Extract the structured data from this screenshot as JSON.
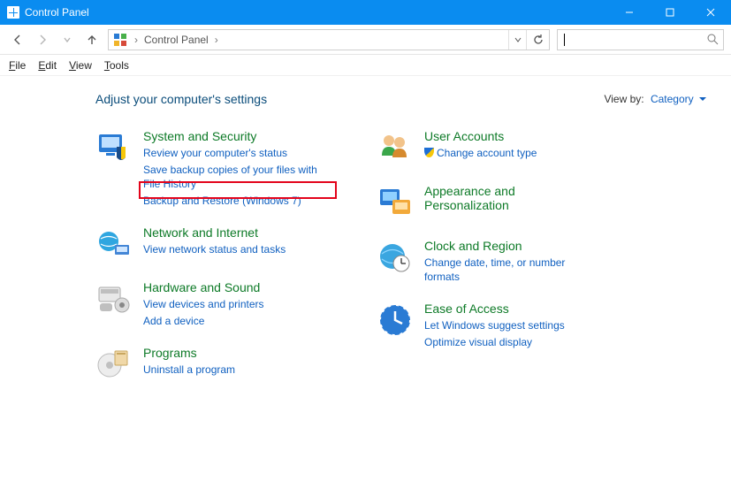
{
  "window": {
    "title": "Control Panel"
  },
  "breadcrumb": {
    "root_sep": "›",
    "item1": "Control Panel",
    "item1_sep": "›"
  },
  "menus": {
    "file": "File",
    "edit": "Edit",
    "view": "View",
    "tools": "Tools"
  },
  "header": {
    "heading": "Adjust your computer's settings",
    "viewby_label": "View by:",
    "viewby_value": "Category"
  },
  "categories": {
    "system_security": {
      "title": "System and Security",
      "links": [
        "Review your computer's status",
        "Save backup copies of your files with File History",
        "Backup and Restore (Windows 7)"
      ]
    },
    "network": {
      "title": "Network and Internet",
      "links": [
        "View network status and tasks"
      ]
    },
    "hardware": {
      "title": "Hardware and Sound",
      "links": [
        "View devices and printers",
        "Add a device"
      ]
    },
    "programs": {
      "title": "Programs",
      "links": [
        "Uninstall a program"
      ]
    },
    "users": {
      "title": "User Accounts",
      "links": [
        "Change account type"
      ]
    },
    "appearance": {
      "title": "Appearance and Personalization",
      "links": []
    },
    "clock": {
      "title": "Clock and Region",
      "links": [
        "Change date, time, or number formats"
      ]
    },
    "ease": {
      "title": "Ease of Access",
      "links": [
        "Let Windows suggest settings",
        "Optimize visual display"
      ]
    }
  },
  "search": {
    "placeholder": ""
  }
}
